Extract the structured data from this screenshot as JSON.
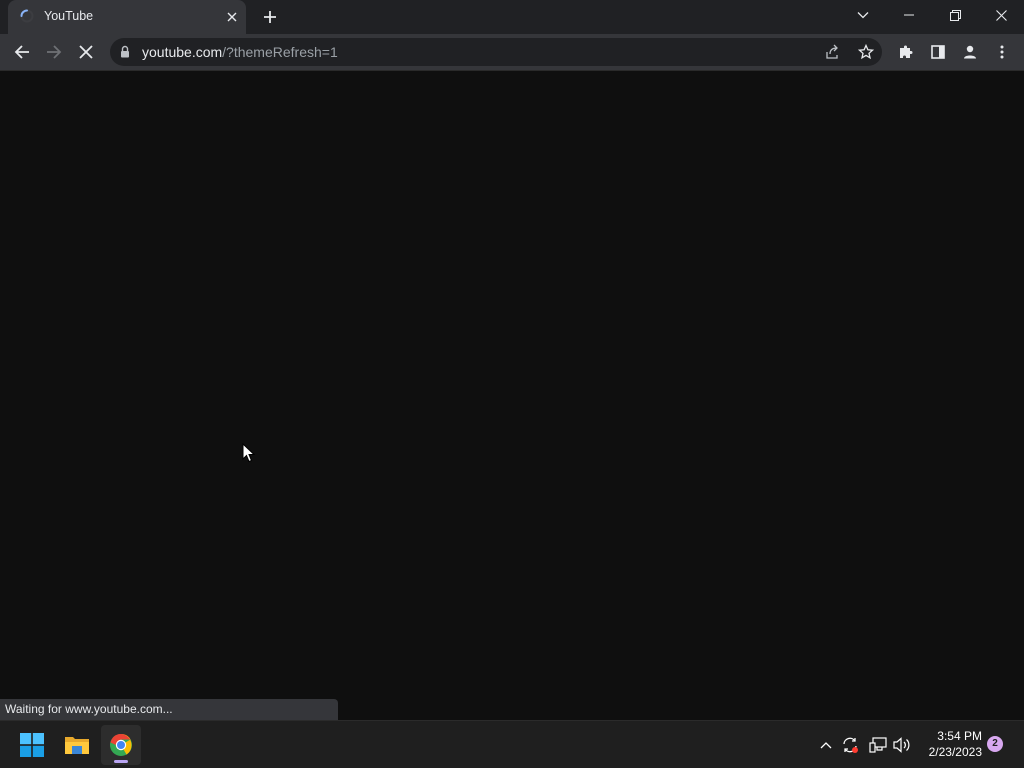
{
  "browser": {
    "tab": {
      "title": "YouTube",
      "state": "loading"
    },
    "address": {
      "host": "youtube.com",
      "path": "/?themeRefresh=1"
    },
    "status_text": "Waiting for www.youtube.com..."
  },
  "icons": {
    "tab": [
      "loading-spinner-icon",
      "close-icon"
    ],
    "titlebar": [
      "plus-icon",
      "chevron-down-icon",
      "minimize-icon",
      "restore-icon",
      "close-icon"
    ],
    "toolbar": [
      "back-arrow-icon",
      "forward-arrow-icon",
      "stop-loading-icon",
      "lock-icon",
      "share-icon",
      "star-icon",
      "puzzle-icon",
      "side-panel-icon",
      "profile-icon",
      "kebab-menu-icon"
    ],
    "taskbar": [
      "windows-start-icon",
      "folder-icon",
      "chrome-icon"
    ],
    "tray": [
      "chevron-up-icon",
      "sync-icon",
      "network-icon",
      "speaker-icon"
    ]
  },
  "taskbar": {
    "clock": {
      "time": "3:54 PM",
      "date": "2/23/2023"
    },
    "notification_count": "2"
  },
  "colors": {
    "page_background": "#0f0f0f",
    "toolbar": "#35363a",
    "titlebar": "#202124",
    "taskbar": "#1f1f1f",
    "accent_indicator": "#b9a5f2"
  }
}
